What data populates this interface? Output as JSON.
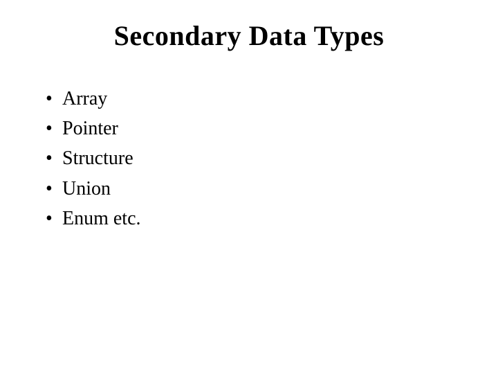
{
  "slide": {
    "title": "Secondary Data Types",
    "bullets": [
      {
        "text": "Array"
      },
      {
        "text": "Pointer"
      },
      {
        "text": "Structure"
      },
      {
        "text": "Union"
      },
      {
        "text": "Enum etc."
      }
    ],
    "bullet_glyph": "•"
  }
}
